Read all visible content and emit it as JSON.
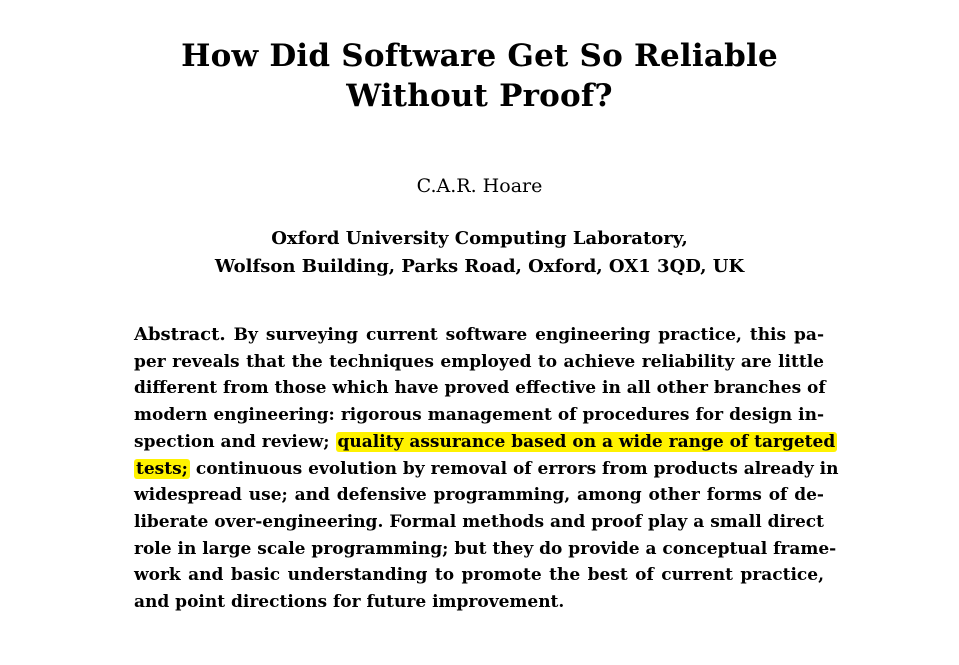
{
  "paper": {
    "title_line1": "How Did Software Get So Reliable",
    "title_line2": "Without Proof?",
    "author": "C.A.R. Hoare",
    "affiliation_line1": "Oxford University Computing Laboratory,",
    "affiliation_line2": "Wolfson Building, Parks Road, Oxford, OX1 3QD, UK",
    "abstract": {
      "label": "Abstract.",
      "line1": "By surveying current software engineering practice, this pa-",
      "line2": "per reveals that the techniques employed to achieve reliability are little",
      "line3": "different from those which have proved effective in all other branches of",
      "line4": "modern engineering: rigorous management of procedures for design in-",
      "line5_before": "spection and review; ",
      "line5_highlight": "quality assurance based on a wide range of targeted",
      "line6_highlight": "tests;",
      "line6_after": " continuous evolution by removal of errors from products already in",
      "line7": "widespread use; and defensive programming, among other forms of de-",
      "line8": "liberate over-engineering. Formal methods and proof play a small direct",
      "line9": "role in large scale programming; but they do provide a conceptual frame-",
      "line10": "work and basic understanding to promote the best of current practice,",
      "line11": "and point directions for future improvement."
    }
  },
  "colors": {
    "highlight": "#fff200",
    "text": "#000000",
    "background": "#ffffff"
  }
}
